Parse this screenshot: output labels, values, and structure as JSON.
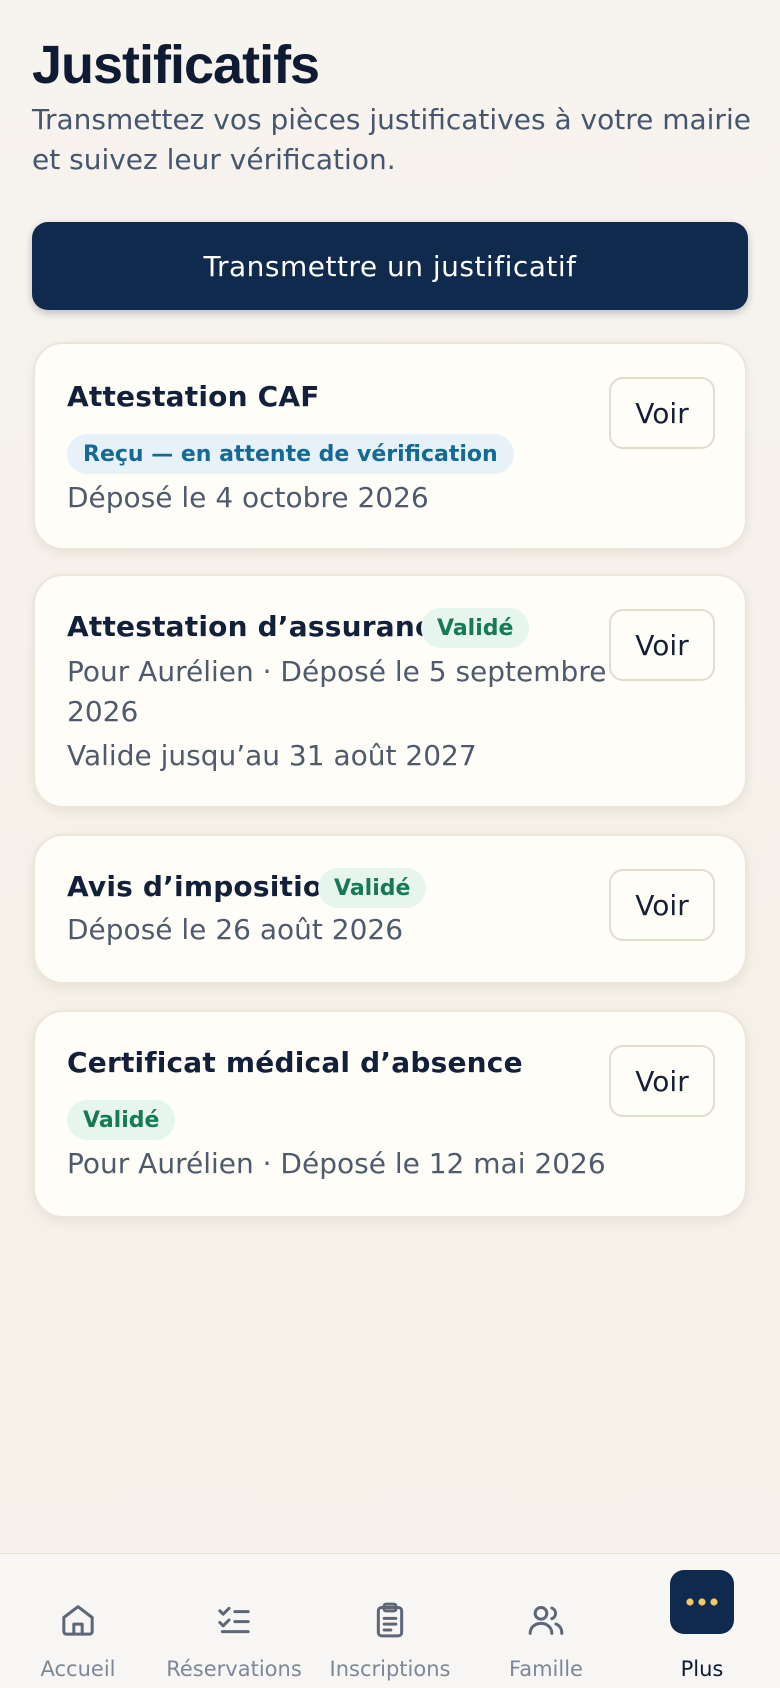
{
  "header": {
    "title": "Justificatifs",
    "subtitle": "Transmettez vos pièces justificatives à votre mairie et suivez leur vérification."
  },
  "cta": {
    "label": "Transmettre un justificatif"
  },
  "documents": [
    {
      "title": "Attestation CAF",
      "status": "Reçu — en attente de vérification",
      "status_kind": "pending",
      "meta_lines": [
        "Déposé le 4 octobre 2026"
      ],
      "action": "Voir"
    },
    {
      "title": "Attestation d’assurance",
      "status": "Validé",
      "status_kind": "valid",
      "meta_lines": [
        "Pour Aurélien · Déposé le 5 septembre",
        "2026",
        "Valide jusqu’au 31 août 2027"
      ],
      "action": "Voir"
    },
    {
      "title": "Avis d’imposition",
      "status": "Validé",
      "status_kind": "valid",
      "meta_lines": [
        "Déposé le 26 août 2026"
      ],
      "action": "Voir"
    },
    {
      "title": "Certificat médical d’absence",
      "status": "Validé",
      "status_kind": "valid",
      "meta_lines": [
        "Pour Aurélien · Déposé le 12 mai 2026"
      ],
      "action": "Voir"
    }
  ],
  "tabbar": {
    "items": [
      {
        "label": "Accueil",
        "icon": "home-icon"
      },
      {
        "label": "Réservations",
        "icon": "checklist-icon"
      },
      {
        "label": "Inscriptions",
        "icon": "clipboard-icon"
      },
      {
        "label": "Famille",
        "icon": "users-icon"
      },
      {
        "label": "Plus",
        "icon": "more-icon",
        "active": true
      }
    ]
  },
  "colors": {
    "primary": "#0f2a4d",
    "pending_bg": "#e6f2f8",
    "pending_text": "#136a96",
    "valid_bg": "#e6f6ef",
    "valid_text": "#177a52"
  }
}
